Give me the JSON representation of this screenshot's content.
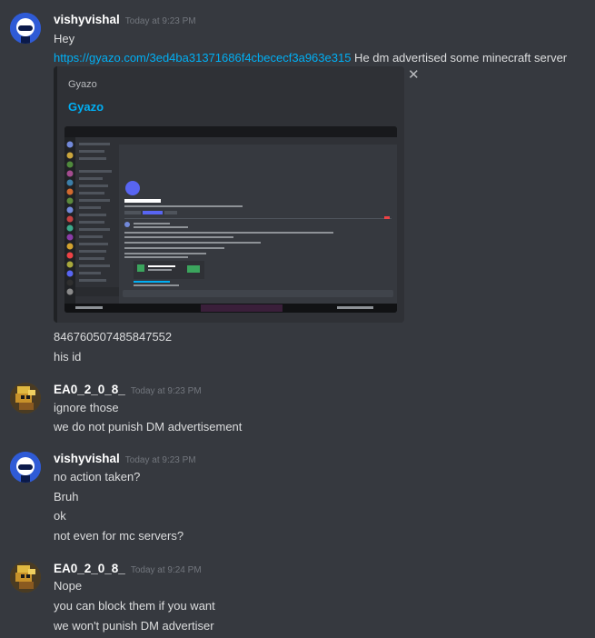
{
  "messages": [
    {
      "username": "vishyvishal",
      "timestamp": "Today at 9:23 PM",
      "avatar_icon": "blue-avatar",
      "lines": [
        "Hey"
      ],
      "link_line": {
        "url_text": "https://gyazo.com/3ed4ba31371686f4cbececf3a963e315",
        "after_text": " He dm advertised some minecraft server"
      },
      "embed": {
        "provider": "Gyazo",
        "title": "Gyazo",
        "thumbnail_icon": "screenshot-thumbnail"
      },
      "after_lines": [
        "846760507485847552",
        "his id"
      ]
    },
    {
      "username": "EA0_2_0_8_",
      "timestamp": "Today at 9:23 PM",
      "avatar_icon": "pixel-avatar",
      "lines": [
        "ignore those",
        "we do not punish DM advertisement"
      ]
    },
    {
      "username": "vishyvishal",
      "timestamp": "Today at 9:23 PM",
      "avatar_icon": "blue-avatar",
      "lines": [
        "no action taken?",
        "Bruh",
        "ok",
        "not even for mc servers?"
      ]
    },
    {
      "username": "EA0_2_0_8_",
      "timestamp": "Today at 9:24 PM",
      "avatar_icon": "pixel-avatar",
      "lines": [
        "Nope",
        "you can block them if you want",
        "we won't punish DM advertiser"
      ]
    }
  ],
  "colors": {
    "background": "#36393f",
    "link": "#00aff4",
    "username": "#ffffff",
    "timestamp": "#72767d"
  }
}
